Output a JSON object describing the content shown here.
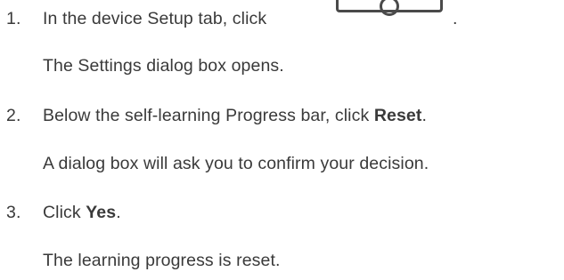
{
  "steps": [
    {
      "number": "1.",
      "text_before": "In the device Setup tab, click",
      "text_after": ".",
      "result": "The Settings dialog box opens."
    },
    {
      "number": "2.",
      "text_before": "Below the self-learning Progress bar, click ",
      "bold": "Reset",
      "text_after": ".",
      "result": "A dialog box will ask you to confirm your decision."
    },
    {
      "number": "3.",
      "text_before": "Click ",
      "bold": "Yes",
      "text_after": ".",
      "result": "The learning progress is reset."
    }
  ],
  "icons": {
    "settings_button": "settings-gear-icon"
  }
}
